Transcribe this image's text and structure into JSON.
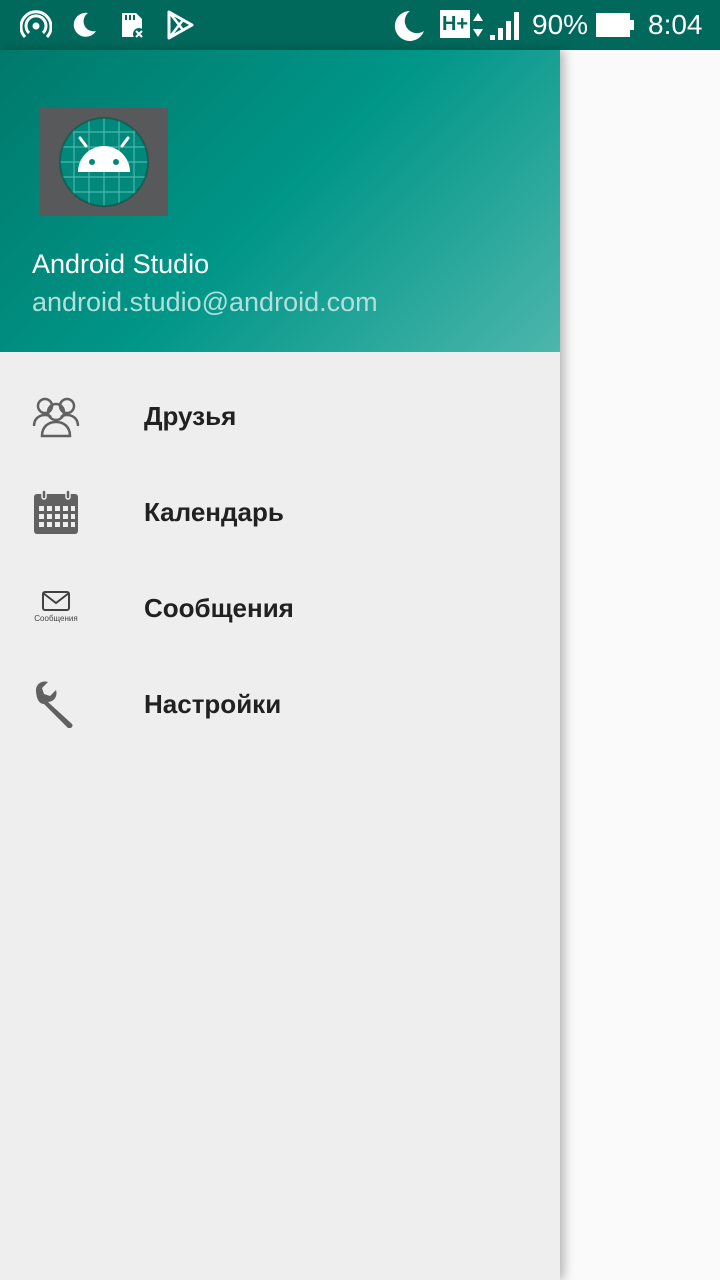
{
  "status_bar": {
    "battery_percent": "90%",
    "time": "8:04",
    "network_type": "H+",
    "icons": [
      "hotspot-icon",
      "do-not-disturb-icon",
      "sd-card-icon",
      "play-store-icon",
      "moon-icon",
      "network-type-icon",
      "signal-icon",
      "battery-icon"
    ]
  },
  "drawer": {
    "header": {
      "name": "Android Studio",
      "email": "android.studio@android.com"
    },
    "items": [
      {
        "label": "Друзья",
        "icon": "friends-icon"
      },
      {
        "label": "Календарь",
        "icon": "calendar-icon"
      },
      {
        "label": "Сообщения",
        "icon": "messages-icon",
        "icon_caption": "Сообщения"
      },
      {
        "label": "Настройки",
        "icon": "wrench-icon"
      }
    ]
  },
  "colors": {
    "status_bar": "#00695c",
    "header_gradient_start": "#00796b",
    "header_gradient_end": "#4db6ac",
    "drawer_background": "#eeeeee",
    "icon_gray": "#616161"
  }
}
